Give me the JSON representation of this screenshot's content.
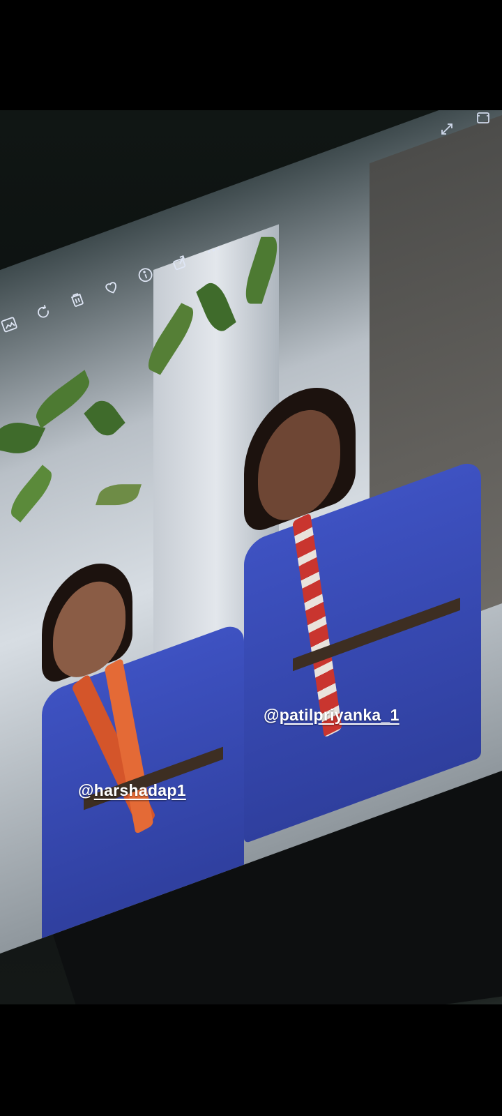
{
  "story": {
    "mentions": [
      {
        "at": "@",
        "handle": "patilpriyanka_1"
      },
      {
        "at": "@",
        "handle": "harshadap1"
      }
    ]
  },
  "viewer_toolbar": {
    "icons": [
      "image-edit-icon",
      "rotate-icon",
      "delete-icon",
      "favorite-icon",
      "info-icon",
      "share-icon",
      "more-options-icon"
    ]
  },
  "corner_controls": {
    "icons": [
      "expand-icon",
      "screenshot-icon"
    ]
  },
  "colors": {
    "background": "#000000",
    "uniform": "#3e52c2",
    "mention_text": "#ffffff"
  }
}
